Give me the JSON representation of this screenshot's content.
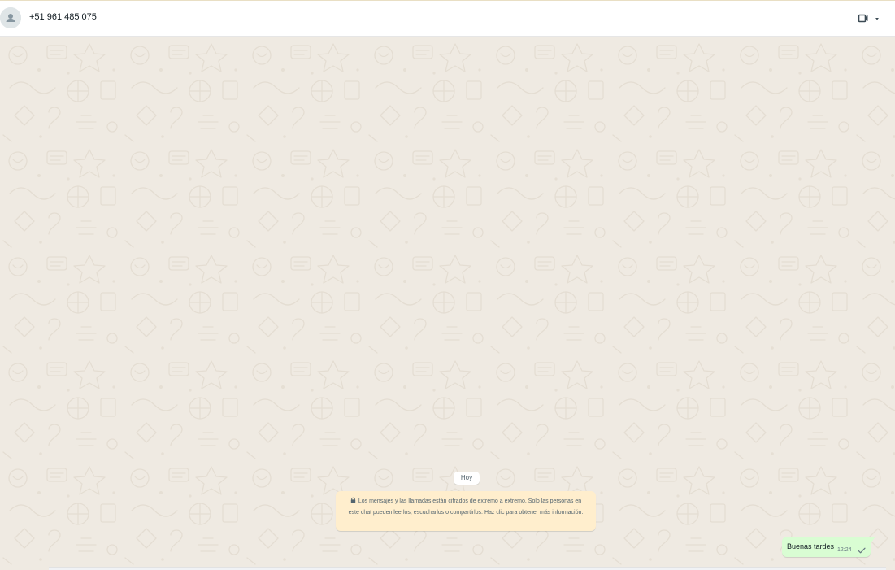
{
  "header": {
    "contact_name": "+51 961 485 075",
    "avatar_icon": "default-person-icon",
    "video_call_icon": "video-camera-icon",
    "video_menu_icon": "chevron-down-icon"
  },
  "chat": {
    "day_chip": "Hoy",
    "encryption_notice": {
      "icon": "lock-icon",
      "text": "Los mensajes y las llamadas están cifrados de extremo a extremo. Solo las personas en este chat pueden leerlos, escucharlos o compartirlos. Haz clic para obtener más información."
    },
    "messages": [
      {
        "direction": "outgoing",
        "text": "Buenas tardes",
        "time": "12:24",
        "status_icon": "single-check-icon"
      }
    ]
  },
  "colors": {
    "chat_background": "#efeae2",
    "outgoing_bubble": "#d9fdd3",
    "notice_background": "#ffeecd",
    "header_background": "#ffffff"
  }
}
